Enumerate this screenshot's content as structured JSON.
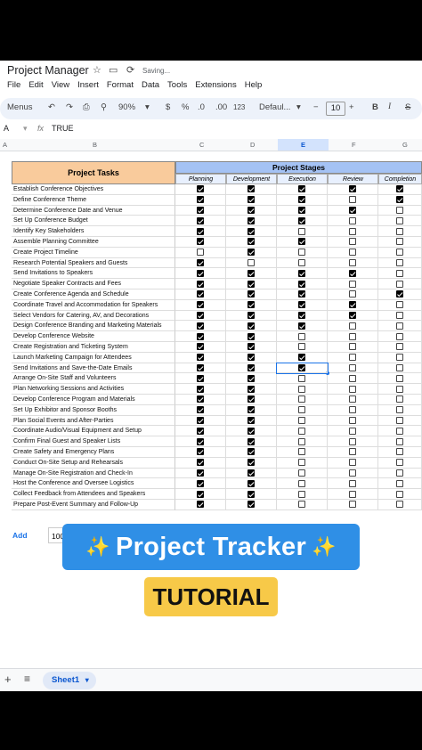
{
  "app": {
    "title": "Project Manager",
    "saving": "Saving...",
    "menu": [
      "File",
      "Edit",
      "View",
      "Insert",
      "Format",
      "Data",
      "Tools",
      "Extensions",
      "Help"
    ]
  },
  "toolbar": {
    "menus_label": "Menus",
    "zoom": "90%",
    "currency": "$",
    "percent": "%",
    "dec_less": ".0",
    "dec_more": ".00",
    "number_format": "123",
    "font": "Defaul...",
    "font_size": "10",
    "bold": "B",
    "italic": "I"
  },
  "formula_bar": {
    "cell_ref": "A",
    "fx": "fx",
    "value": "TRUE"
  },
  "columns": [
    "A",
    "B",
    "C",
    "D",
    "E",
    "F",
    "G"
  ],
  "sheet": {
    "tasks_header": "Project Tasks",
    "stages_header": "Project Stages",
    "stages": [
      "Planning",
      "Development",
      "Execution",
      "Review",
      "Completion"
    ],
    "rows": [
      {
        "task": "Establish Conference Objectives",
        "checks": [
          true,
          true,
          true,
          true,
          true
        ]
      },
      {
        "task": "Define Conference Theme",
        "checks": [
          true,
          true,
          true,
          false,
          true
        ]
      },
      {
        "task": "Determine Conference Date and Venue",
        "checks": [
          true,
          true,
          true,
          true,
          false
        ]
      },
      {
        "task": "Set Up Conference Budget",
        "checks": [
          true,
          true,
          true,
          false,
          false
        ]
      },
      {
        "task": "Identify Key Stakeholders",
        "checks": [
          true,
          true,
          false,
          false,
          false
        ]
      },
      {
        "task": "Assemble Planning Committee",
        "checks": [
          true,
          true,
          true,
          false,
          false
        ]
      },
      {
        "task": "Create Project Timeline",
        "checks": [
          false,
          true,
          false,
          false,
          false
        ]
      },
      {
        "task": "Research Potential Speakers and Guests",
        "checks": [
          true,
          false,
          false,
          false,
          false
        ]
      },
      {
        "task": "Send Invitations to Speakers",
        "checks": [
          true,
          true,
          true,
          true,
          false
        ]
      },
      {
        "task": "Negotiate Speaker Contracts and Fees",
        "checks": [
          true,
          true,
          true,
          false,
          false
        ]
      },
      {
        "task": "Create Conference Agenda and Schedule",
        "checks": [
          true,
          true,
          true,
          false,
          true
        ]
      },
      {
        "task": "Coordinate Travel and Accommodation for Speakers",
        "checks": [
          true,
          true,
          true,
          true,
          false
        ]
      },
      {
        "task": "Select Vendors for Catering, AV, and Decorations",
        "checks": [
          true,
          true,
          true,
          true,
          false
        ]
      },
      {
        "task": "Design Conference Branding and Marketing Materials",
        "checks": [
          true,
          true,
          true,
          false,
          false
        ]
      },
      {
        "task": "Develop Conference Website",
        "checks": [
          true,
          true,
          false,
          false,
          false
        ]
      },
      {
        "task": "Create Registration and Ticketing System",
        "checks": [
          true,
          true,
          false,
          false,
          false
        ]
      },
      {
        "task": "Launch Marketing Campaign for Attendees",
        "checks": [
          true,
          true,
          true,
          false,
          false
        ]
      },
      {
        "task": "Send Invitations and Save-the-Date Emails",
        "checks": [
          true,
          true,
          true,
          false,
          false
        ]
      },
      {
        "task": "Arrange On-Site Staff and Volunteers",
        "checks": [
          true,
          true,
          false,
          false,
          false
        ]
      },
      {
        "task": "Plan Networking Sessions and Activities",
        "checks": [
          true,
          true,
          false,
          false,
          false
        ]
      },
      {
        "task": "Develop Conference Program and Materials",
        "checks": [
          true,
          true,
          false,
          false,
          false
        ]
      },
      {
        "task": "Set Up Exhibitor and Sponsor Booths",
        "checks": [
          true,
          true,
          false,
          false,
          false
        ]
      },
      {
        "task": "Plan Social Events and After-Parties",
        "checks": [
          true,
          true,
          false,
          false,
          false
        ]
      },
      {
        "task": "Coordinate Audio/Visual Equipment and Setup",
        "checks": [
          true,
          true,
          false,
          false,
          false
        ]
      },
      {
        "task": "Confirm Final Guest and Speaker Lists",
        "checks": [
          true,
          true,
          false,
          false,
          false
        ]
      },
      {
        "task": "Create Safety and Emergency Plans",
        "checks": [
          true,
          true,
          false,
          false,
          false
        ]
      },
      {
        "task": "Conduct On-Site Setup and Rehearsals",
        "checks": [
          true,
          true,
          false,
          false,
          false
        ]
      },
      {
        "task": "Manage On-Site Registration and Check-In",
        "checks": [
          true,
          true,
          false,
          false,
          false
        ]
      },
      {
        "task": "Host the Conference and Oversee Logistics",
        "checks": [
          true,
          true,
          false,
          false,
          false
        ]
      },
      {
        "task": "Collect Feedback from Attendees and Speakers",
        "checks": [
          true,
          true,
          false,
          false,
          false
        ]
      },
      {
        "task": "Prepare Post-Event Summary and Follow-Up",
        "checks": [
          true,
          true,
          false,
          false,
          false
        ]
      }
    ]
  },
  "add_rows": {
    "label": "Add",
    "value": "100"
  },
  "overlay": {
    "banner": "Project Tracker",
    "sparkle": "✨",
    "badge": "TUTORIAL"
  },
  "sheet_tab": {
    "add": "+",
    "list": "≡",
    "name": "Sheet1"
  }
}
